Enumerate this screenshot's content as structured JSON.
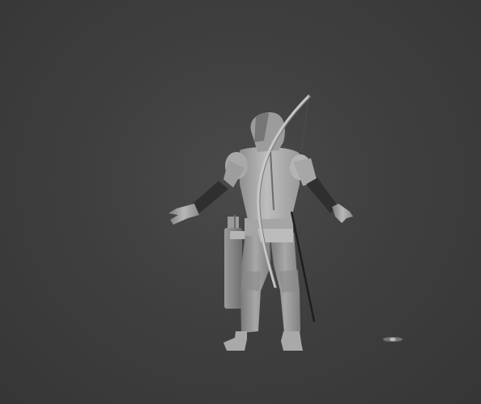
{
  "viewport": {
    "background_color": "#3d3d3d",
    "model_shade_light": "#b5b5b5",
    "model_shade_mid": "#8e8e8e",
    "model_shade_dark": "#5a5a5a",
    "glove_color": "#2e2e2e"
  },
  "scene": {
    "objects": [
      {
        "name": "archer-character-model"
      },
      {
        "name": "longbow"
      },
      {
        "name": "quiver"
      },
      {
        "name": "walking-staff"
      },
      {
        "name": "ground-marker"
      }
    ]
  }
}
